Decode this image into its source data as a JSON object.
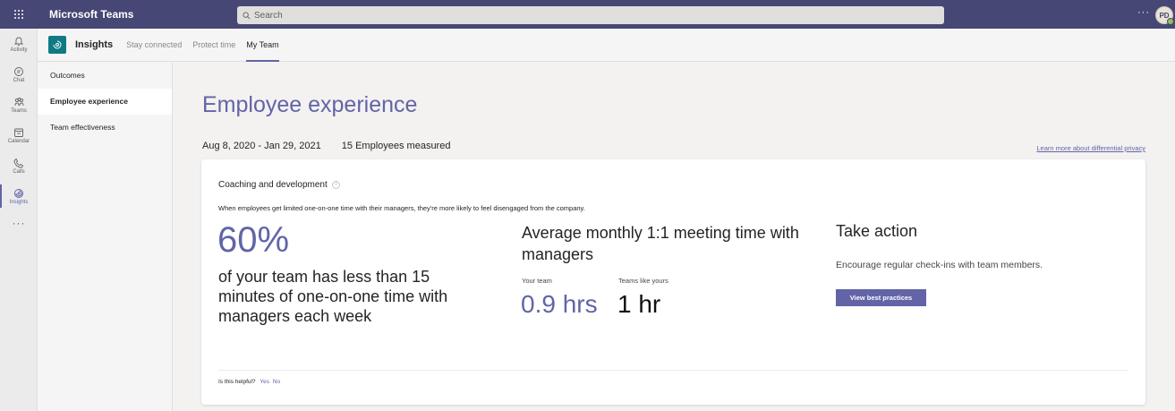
{
  "topbar": {
    "app_title": "Microsoft Teams",
    "search_placeholder": "Search",
    "more_label": "···",
    "avatar_initials": "PD"
  },
  "rail": {
    "items": [
      {
        "label": "Activity",
        "icon": "bell-icon"
      },
      {
        "label": "Chat",
        "icon": "chat-icon"
      },
      {
        "label": "Teams",
        "icon": "teams-icon"
      },
      {
        "label": "Calendar",
        "icon": "calendar-icon"
      },
      {
        "label": "Calls",
        "icon": "phone-icon"
      },
      {
        "label": "Insights",
        "icon": "insights-icon"
      }
    ],
    "more_label": "···"
  },
  "header": {
    "app_name": "Insights",
    "tabs": [
      {
        "label": "Stay connected"
      },
      {
        "label": "Protect time"
      },
      {
        "label": "My Team"
      }
    ]
  },
  "leftnav": {
    "items": [
      {
        "label": "Outcomes"
      },
      {
        "label": "Employee experience"
      },
      {
        "label": "Team effectiveness"
      }
    ]
  },
  "main": {
    "title": "Employee experience",
    "date_range": "Aug 8, 2020 - Jan 29, 2021",
    "employees_measured": "15 Employees measured",
    "privacy_link": "Learn more about differential privacy",
    "card": {
      "title": "Coaching and development",
      "description": "When employees get limited one-on-one time with their managers, they're more likely to feel disengaged from the company.",
      "big_stat": "60%",
      "big_stat_text": "of your team has less than 15 minutes of one-on-one time with managers each week",
      "metric_title": "Average monthly 1:1 meeting time with managers",
      "your_team_label": "Your team",
      "your_team_value": "0.9 hrs",
      "teams_like_label": "Teams like yours",
      "teams_like_value": "1 hr",
      "action_title": "Take action",
      "action_desc": "Encourage regular check-ins with team members.",
      "action_button": "View best practices",
      "helpful_question": "Is this helpful?",
      "helpful_yes": "Yes",
      "helpful_no": "No"
    }
  },
  "colors": {
    "accent": "#6264a7",
    "topbar": "#464775",
    "app_logo": "#0f7a83"
  }
}
